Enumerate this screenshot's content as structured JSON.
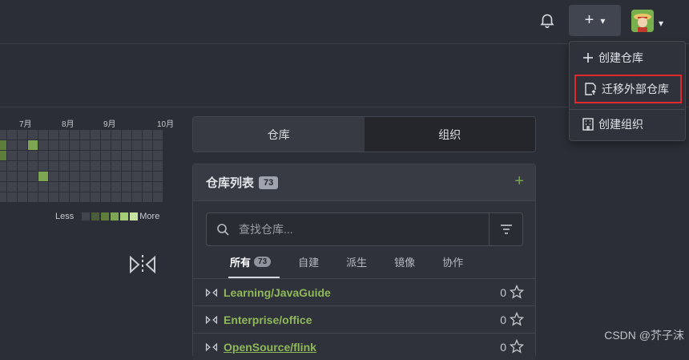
{
  "topbar": {
    "plus_symbol": "+",
    "caret": "▾"
  },
  "heatmap": {
    "months": [
      "7月",
      "8月",
      "9月",
      "10月"
    ],
    "legend_less": "Less",
    "legend_more": "More",
    "legend_colors": [
      "#41444c",
      "#4a5c3a",
      "#5e7d3b",
      "#7ea554",
      "#a6cc78",
      "#c6e3a1"
    ]
  },
  "tabs": {
    "repos": "仓库",
    "orgs": "组织"
  },
  "repo_panel": {
    "title": "仓库列表",
    "count": "73",
    "add_symbol": "+",
    "search_placeholder": "查找仓库...",
    "subtabs": [
      {
        "label": "所有",
        "count": "73"
      },
      {
        "label": "自建"
      },
      {
        "label": "派生"
      },
      {
        "label": "镜像"
      },
      {
        "label": "协作"
      }
    ],
    "repos": [
      {
        "name": "Learning/JavaGuide",
        "stars": "0"
      },
      {
        "name": "Enterprise/office",
        "stars": "0"
      },
      {
        "name": "OpenSource/flink",
        "stars": "0"
      }
    ]
  },
  "dropdown": {
    "items": [
      {
        "label": "创建仓库",
        "icon": "plus-icon"
      },
      {
        "label": "迁移外部仓库",
        "icon": "migrate-icon"
      },
      {
        "label": "创建组织",
        "icon": "building-icon"
      }
    ]
  },
  "watermark": "CSDN @芥子沫",
  "colors": {
    "accent_green": "#8fb85a",
    "highlight_red": "#e0272b"
  }
}
